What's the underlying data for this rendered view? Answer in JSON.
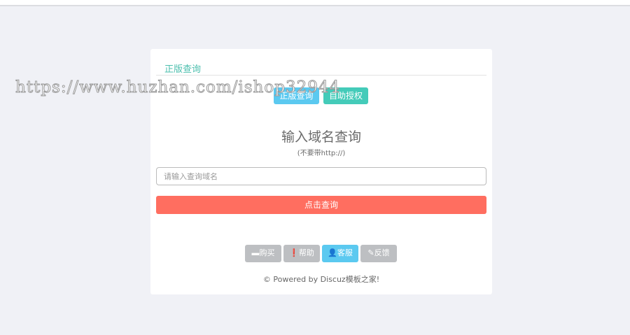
{
  "tab_title": "正版查询",
  "mode_buttons": [
    "正版查询",
    "自助授权"
  ],
  "heading": "输入域名查询",
  "subheading": "(不要带http://)",
  "domain_input": {
    "value": "",
    "placeholder": "请输入查询域名"
  },
  "submit_label": "点击查询",
  "small_buttons": [
    {
      "icon": "card-icon",
      "glyph": "▬",
      "label": "购买"
    },
    {
      "icon": "exclamation-icon",
      "glyph": "❗",
      "label": "帮助"
    },
    {
      "icon": "user-icon",
      "glyph": "👤",
      "label": "客服"
    },
    {
      "icon": "pencil-icon",
      "glyph": "✎",
      "label": "反馈"
    }
  ],
  "footer": "© Powered by Discuz模板之家!",
  "watermark": "https://www.huzhan.com/ishop32944"
}
